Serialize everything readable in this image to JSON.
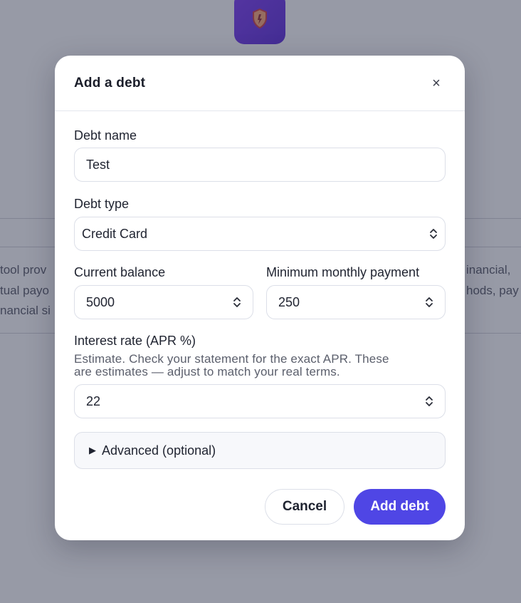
{
  "background": {
    "text_left": [
      "tool prov",
      "tual payo",
      "nancial si"
    ],
    "text_right": [
      "inancial,",
      "hods, pay"
    ]
  },
  "modal": {
    "title": "Add a debt",
    "close_symbol": "×",
    "fields": {
      "debt_name": {
        "label": "Debt name",
        "value": "Test"
      },
      "debt_type": {
        "label": "Debt type",
        "value": "Credit Card"
      },
      "current_balance": {
        "label": "Current balance",
        "value": "5000"
      },
      "minimum_payment": {
        "label": "Minimum monthly payment",
        "value": "250"
      },
      "interest_rate": {
        "label": "Interest rate (APR %)",
        "help_line1": "Estimate. Check your statement for the exact APR. These",
        "help_line2": "are estimates — adjust to match your real terms.",
        "value": "22"
      }
    },
    "advanced": {
      "label": "Advanced (optional)",
      "arrow": "▶"
    },
    "buttons": {
      "cancel": "Cancel",
      "submit": "Add debt"
    }
  },
  "colors": {
    "accent": "#4f46e5",
    "logo": "#6a36e3",
    "overlay": "#9fa0aa"
  },
  "icons": {
    "logo": "shield-icon",
    "close": "close-icon",
    "stepper": "stepper-icon",
    "select": "select-chevrons-icon",
    "disclosure": "disclosure-triangle-icon"
  }
}
